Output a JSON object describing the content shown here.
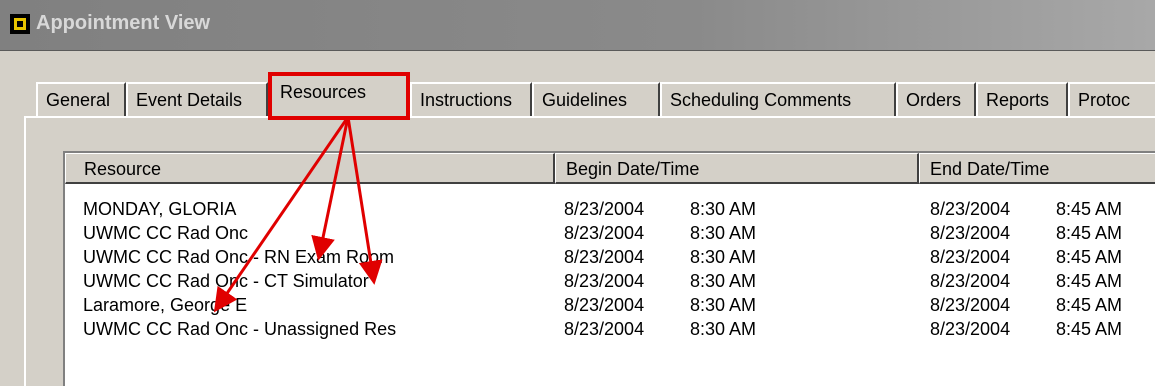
{
  "window": {
    "title": "Appointment View",
    "icon": "calendar-app-icon"
  },
  "tabs": [
    {
      "label": "General"
    },
    {
      "label": "Event Details"
    },
    {
      "label": "Resources",
      "active": true
    },
    {
      "label": "Instructions"
    },
    {
      "label": "Guidelines"
    },
    {
      "label": "Scheduling Comments"
    },
    {
      "label": "Orders"
    },
    {
      "label": "Reports"
    },
    {
      "label": "Protoc"
    }
  ],
  "table": {
    "columns": [
      "Resource",
      "Begin Date/Time",
      "End Date/Time"
    ],
    "rows": [
      {
        "resource": "MONDAY, GLORIA",
        "begin_date": "8/23/2004",
        "begin_time": "8:30 AM",
        "end_date": "8/23/2004",
        "end_time": "8:45 AM"
      },
      {
        "resource": "UWMC CC Rad Onc",
        "begin_date": "8/23/2004",
        "begin_time": "8:30 AM",
        "end_date": "8/23/2004",
        "end_time": "8:45 AM"
      },
      {
        "resource": "UWMC CC Rad Onc - RN Exam Room",
        "begin_date": "8/23/2004",
        "begin_time": "8:30 AM",
        "end_date": "8/23/2004",
        "end_time": "8:45 AM"
      },
      {
        "resource": "UWMC CC Rad Onc - CT Simulator",
        "begin_date": "8/23/2004",
        "begin_time": "8:30 AM",
        "end_date": "8/23/2004",
        "end_time": "8:45 AM"
      },
      {
        "resource": "Laramore, George E",
        "begin_date": "8/23/2004",
        "begin_time": "8:30 AM",
        "end_date": "8/23/2004",
        "end_time": "8:45 AM"
      },
      {
        "resource": "UWMC CC Rad Onc - Unassigned Res",
        "begin_date": "8/23/2004",
        "begin_time": "8:30 AM",
        "end_date": "8/23/2004",
        "end_time": "8:45 AM"
      }
    ]
  },
  "annotation": {
    "color": "#e00000"
  }
}
